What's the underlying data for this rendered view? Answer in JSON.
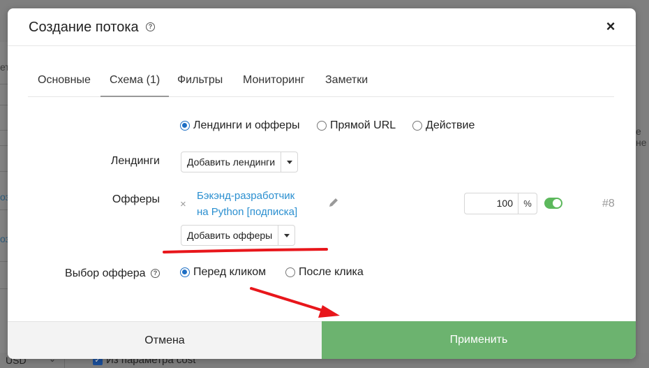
{
  "background": {
    "left_fragments": [
      "ет",
      "оз",
      "оз"
    ],
    "right_fragment": "е не",
    "currency": "USD",
    "cost_checkbox_label": "Из параметра cost"
  },
  "modal": {
    "title": "Создание потока",
    "close_label": "×",
    "tabs": [
      {
        "label": "Основные",
        "active": false
      },
      {
        "label": "Схема (1)",
        "active": true
      },
      {
        "label": "Фильтры",
        "active": false
      },
      {
        "label": "Мониторинг",
        "active": false
      },
      {
        "label": "Заметки",
        "active": false
      }
    ],
    "schema_types": [
      {
        "label": "Лендинги и офферы",
        "selected": true
      },
      {
        "label": "Прямой URL",
        "selected": false
      },
      {
        "label": "Действие",
        "selected": false
      }
    ],
    "landings": {
      "label": "Лендинги",
      "add_button": "Добавить лендинги"
    },
    "offers": {
      "label": "Офферы",
      "items": [
        {
          "name_line1": "Бэкэнд-разработчик",
          "name_line2": "на Python [подписка]",
          "remove_label": "×",
          "weight": "100",
          "weight_unit": "%",
          "enabled": true,
          "id_label": "#8"
        }
      ],
      "add_button": "Добавить офферы"
    },
    "offer_selection": {
      "label": "Выбор оффера",
      "options": [
        {
          "label": "Перед кликом",
          "selected": true
        },
        {
          "label": "После клика",
          "selected": false
        }
      ]
    },
    "footer": {
      "cancel": "Отмена",
      "apply": "Применить"
    }
  },
  "colors": {
    "accent_blue": "#1f6fc4",
    "link_blue": "#2a8fd0",
    "apply_green": "#6cb36f",
    "toggle_green": "#5cb85c",
    "annotation_red": "#e8161b"
  }
}
